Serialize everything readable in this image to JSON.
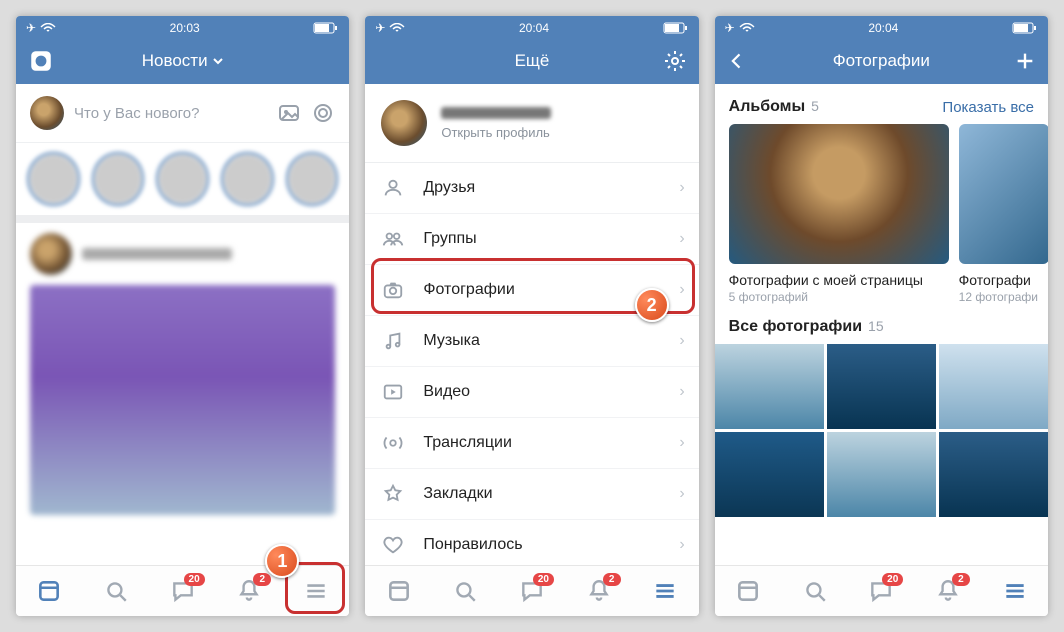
{
  "s1": {
    "time": "20:03",
    "header_title": "Новости",
    "composer_placeholder": "Что у Вас нового?",
    "tab_msg_badge": "20",
    "tab_notif_badge": "2"
  },
  "s2": {
    "time": "20:04",
    "header_title": "Ещё",
    "profile_sub": "Открыть профиль",
    "menu": {
      "friends": "Друзья",
      "groups": "Группы",
      "photos": "Фотографии",
      "music": "Музыка",
      "video": "Видео",
      "live": "Трансляции",
      "bookmarks": "Закладки",
      "liked": "Понравилось"
    },
    "tab_msg_badge": "20",
    "tab_notif_badge": "2"
  },
  "s3": {
    "time": "20:04",
    "header_title": "Фотографии",
    "albums_title": "Альбомы",
    "albums_count": "5",
    "show_all": "Показать все",
    "album1_title": "Фотографии с моей страницы",
    "album1_sub": "5 фотографий",
    "album2_title": "Фотографи",
    "album2_sub": "12 фотографи",
    "all_title": "Все фотографии",
    "all_count": "15",
    "tab_msg_badge": "20",
    "tab_notif_badge": "2"
  },
  "callouts": {
    "n1": "1",
    "n2": "2"
  }
}
